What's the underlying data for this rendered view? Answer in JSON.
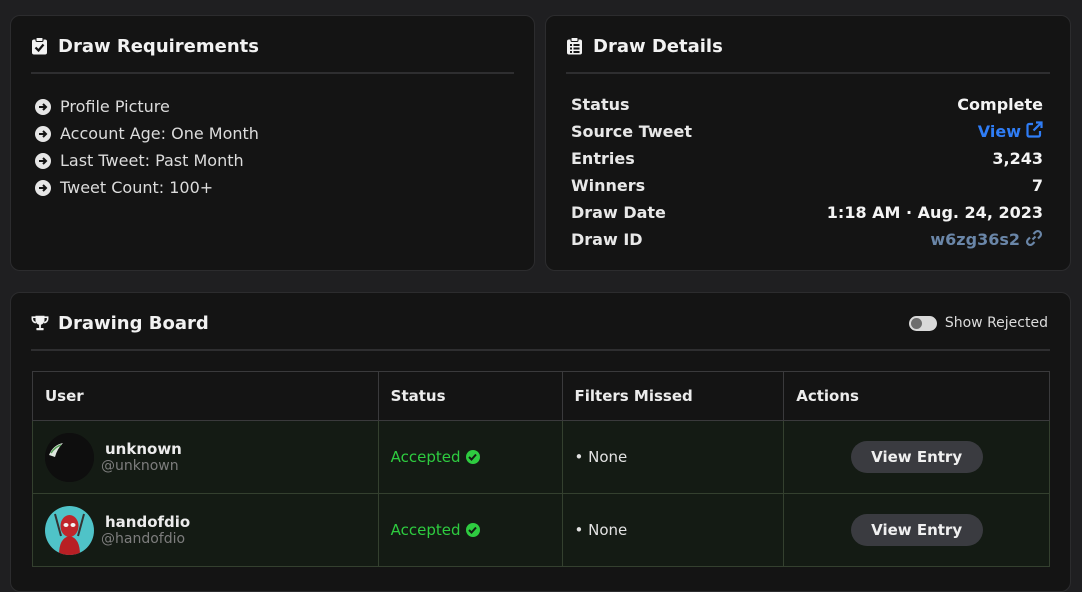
{
  "requirements": {
    "title": "Draw Requirements",
    "items": [
      "Profile Picture",
      "Account Age: One Month",
      "Last Tweet: Past Month",
      "Tweet Count: 100+"
    ]
  },
  "details": {
    "title": "Draw Details",
    "status_label": "Status",
    "status_value": "Complete",
    "source_label": "Source Tweet",
    "source_value": "View",
    "entries_label": "Entries",
    "entries_value": "3,243",
    "winners_label": "Winners",
    "winners_value": "7",
    "date_label": "Draw Date",
    "date_value": "1:18 AM · Aug. 24, 2023",
    "id_label": "Draw ID",
    "id_value": "w6zg36s2"
  },
  "board": {
    "title": "Drawing Board",
    "toggle_label": "Show Rejected",
    "columns": [
      "User",
      "Status",
      "Filters Missed",
      "Actions"
    ],
    "rows": [
      {
        "name": "unknown",
        "handle": "@unknown",
        "status": "Accepted",
        "filters": "• None",
        "action": "View Entry"
      },
      {
        "name": "handofdio",
        "handle": "@handofdio",
        "status": "Accepted",
        "filters": "• None",
        "action": "View Entry"
      }
    ]
  },
  "colors": {
    "accent_link": "#2f7df6",
    "accepted_green": "#2ecc40",
    "id_link": "#6a86a8"
  }
}
